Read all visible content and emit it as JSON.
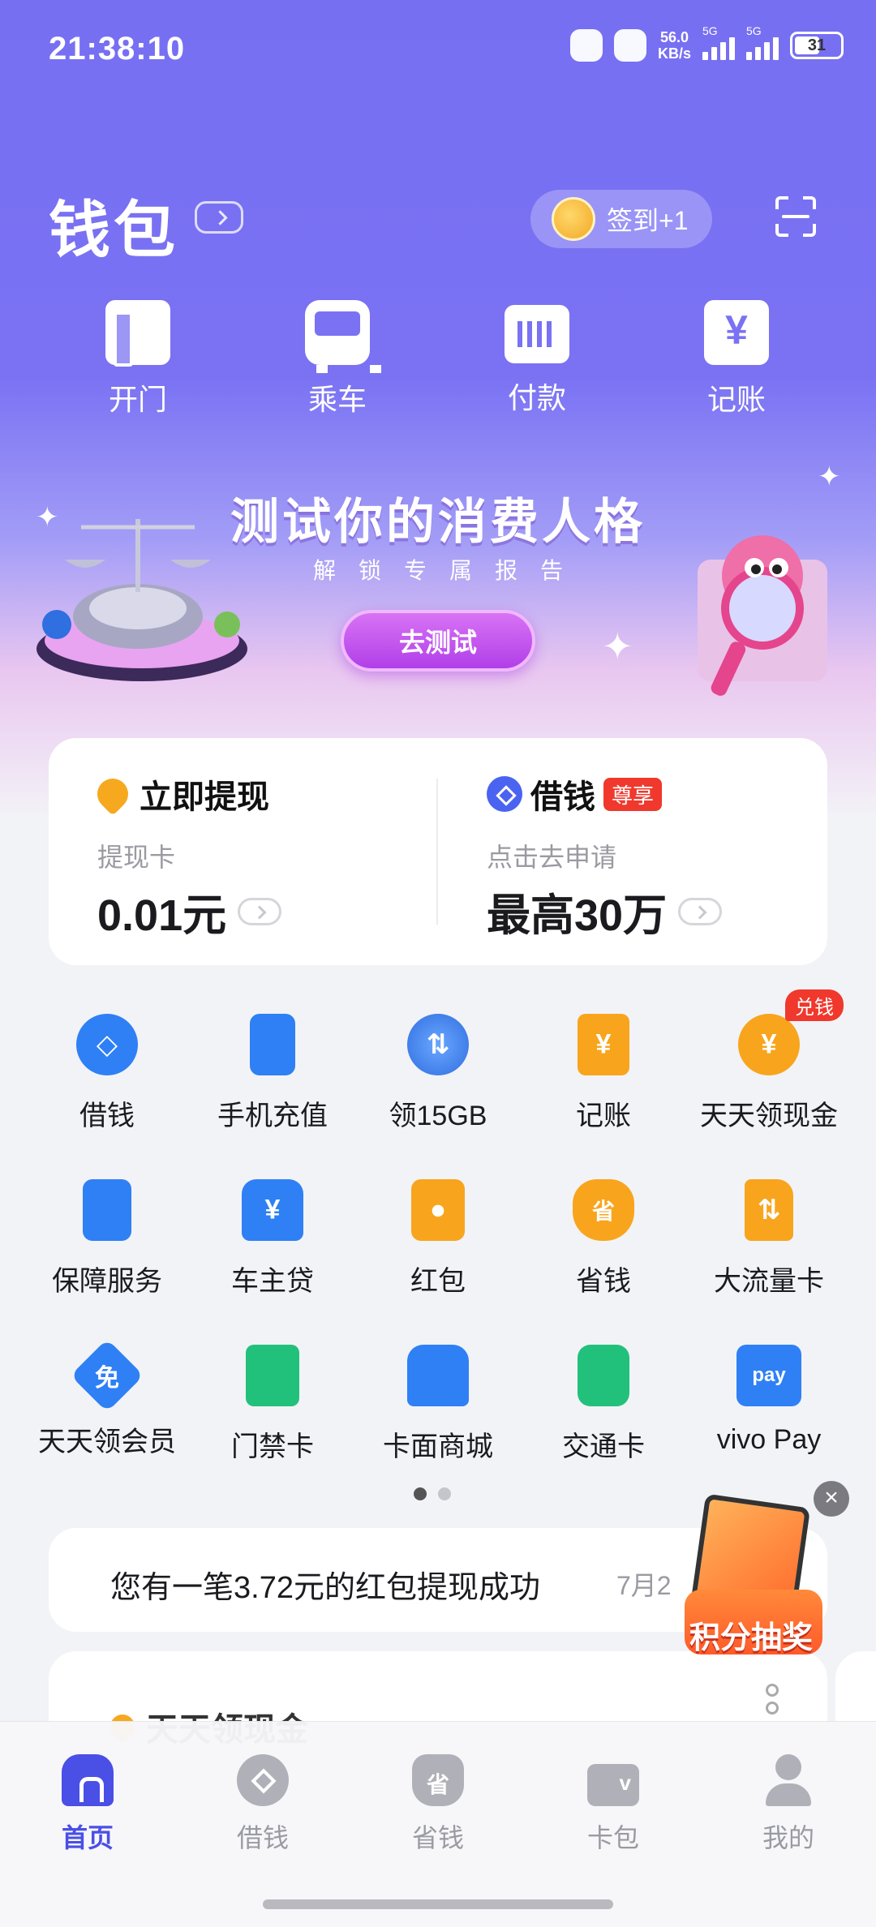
{
  "status_bar": {
    "time": "21:38:10",
    "net_speed": "56.0",
    "net_unit": "KB/s",
    "network_1": "5G",
    "network_2": "5G",
    "battery": "31"
  },
  "header": {
    "title": "钱包",
    "checkin_label": "签到+1"
  },
  "quick_actions": [
    {
      "label": "开门",
      "icon": "door-icon"
    },
    {
      "label": "乘车",
      "icon": "bus-icon"
    },
    {
      "label": "付款",
      "icon": "barcode-icon"
    },
    {
      "label": "记账",
      "icon": "ledger-icon"
    }
  ],
  "banner": {
    "title": "测试你的消费人格",
    "subtitle": "解锁专属报告",
    "button": "去测试"
  },
  "money_card": {
    "left": {
      "title": "立即提现",
      "sub": "提现卡",
      "value": "0.01元"
    },
    "right": {
      "title": "借钱",
      "badge": "尊享",
      "sub": "点击去申请",
      "value": "最高30万"
    }
  },
  "services": [
    {
      "label": "借钱",
      "icon": "loan-icon"
    },
    {
      "label": "手机充值",
      "icon": "phone-icon"
    },
    {
      "label": "领15GB",
      "icon": "data-icon"
    },
    {
      "label": "记账",
      "icon": "ledger-icon"
    },
    {
      "label": "天天领现金",
      "icon": "cash-coin-icon",
      "badge": "兑钱"
    },
    {
      "label": "保障服务",
      "icon": "protection-icon"
    },
    {
      "label": "车主贷",
      "icon": "car-loan-icon"
    },
    {
      "label": "红包",
      "icon": "red-packet-icon"
    },
    {
      "label": "省钱",
      "icon": "savings-bag-icon"
    },
    {
      "label": "大流量卡",
      "icon": "sim-card-icon"
    },
    {
      "label": "天天领会员",
      "icon": "membership-icon"
    },
    {
      "label": "门禁卡",
      "icon": "access-card-icon"
    },
    {
      "label": "卡面商城",
      "icon": "tshirt-icon"
    },
    {
      "label": "交通卡",
      "icon": "transit-icon"
    },
    {
      "label": "vivo Pay",
      "icon": "vivo-pay-icon"
    }
  ],
  "notice": {
    "text": "您有一笔3.72元的红包提现成功",
    "date": "7月2"
  },
  "next_card": {
    "title": "天天领现金"
  },
  "promo": {
    "label": "积分抽奖"
  },
  "tabs": [
    {
      "label": "首页"
    },
    {
      "label": "借钱"
    },
    {
      "label": "省钱"
    },
    {
      "label": "卡包"
    },
    {
      "label": "我的"
    }
  ]
}
